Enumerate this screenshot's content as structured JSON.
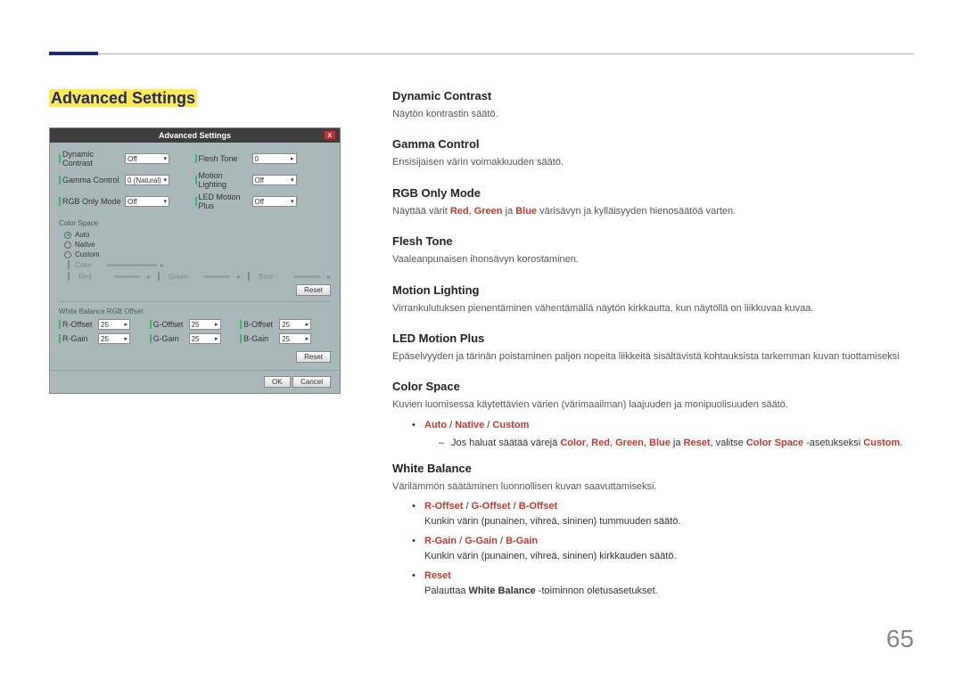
{
  "pageNumber": "65",
  "sectionTitle": "Advanced Settings",
  "dialog": {
    "title": "Advanced Settings",
    "close": "x",
    "topRows": [
      {
        "label": "Dynamic Contrast",
        "value": "Off",
        "label2": "Flesh Tone",
        "value2": "0"
      },
      {
        "label": "Gamma Control",
        "value": "0 (Natural)",
        "label2": "Motion Lighting",
        "value2": "Off"
      },
      {
        "label": "RGB Only Mode",
        "value": "Off",
        "label2": "LED Motion Plus",
        "value2": "Off"
      }
    ],
    "colorSpace": {
      "title": "Color Space",
      "options": [
        "Auto",
        "Native",
        "Custom"
      ],
      "sliders": [
        {
          "l": "Color",
          "v": ""
        }
      ],
      "rgbSliders": [
        {
          "l": "Red",
          "v": ""
        },
        {
          "l": "Green",
          "v": ""
        },
        {
          "l": "Blue",
          "v": ""
        }
      ],
      "reset": "Reset"
    },
    "whiteBalance": {
      "title": "White Balance RGB Offset",
      "rows": [
        [
          {
            "l": "R-Offset",
            "v": "25"
          },
          {
            "l": "G-Offset",
            "v": "25"
          },
          {
            "l": "B-Offset",
            "v": "25"
          }
        ],
        [
          {
            "l": "R-Gain",
            "v": "25"
          },
          {
            "l": "G-Gain",
            "v": "25"
          },
          {
            "l": "B-Gain",
            "v": "25"
          }
        ]
      ],
      "reset": "Reset"
    },
    "ok": "OK",
    "cancel": "Cancel"
  },
  "items": {
    "dynamicContrast": {
      "title": "Dynamic Contrast",
      "desc": "Näytön kontrastin säätö."
    },
    "gammaControl": {
      "title": "Gamma Control",
      "desc": "Ensisijaisen värin voimakkuuden säätö."
    },
    "rgbOnly": {
      "title": "RGB Only Mode",
      "descPre": "Näyttää värit ",
      "red": "Red",
      "sep1": ", ",
      "green": "Green",
      "sep2": " ja ",
      "blue": "Blue",
      "descPost": " värisävyn ja kylläisyyden hienosäätöä varten."
    },
    "fleshTone": {
      "title": "Flesh Tone",
      "desc": "Vaaleanpunaisen ihonsävyn korostaminen."
    },
    "motionLighting": {
      "title": "Motion Lighting",
      "desc": "Virrankulutuksen pienentäminen vähentämällä näytön kirkkautta, kun näytöllä on liikkuvaa kuvaa."
    },
    "ledMotionPlus": {
      "title": "LED Motion Plus",
      "desc": "Epäselvyyden ja tärinän poistaminen paljon nopeita liikkeitä sisältävistä kohtauksista tarkemman kuvan tuottamiseksi"
    },
    "colorSpace": {
      "title": "Color Space",
      "desc": "Kuvien luomisessa käytettävien värien (värimaailman) laajuuden ja monipuolisuuden säätö.",
      "opts": {
        "auto": "Auto",
        "native": "Native",
        "custom": "Custom",
        "sep": " / "
      },
      "subPre": "Jos haluat säätää värejä ",
      "color": "Color",
      "s1": ", ",
      "red": "Red",
      "s2": ", ",
      "green": "Green",
      "s3": ", ",
      "blue": "Blue",
      "s4": " ja ",
      "reset": "Reset",
      "s5": ", valitse ",
      "cs": "Color Space",
      "s6": " -asetukseksi ",
      "custom2": "Custom",
      "s7": "."
    },
    "whiteBalance": {
      "title": "White Balance",
      "desc": "Värilämmön säätäminen luonnollisen kuvan saavuttamiseksi.",
      "b1": {
        "r": "R-Offset",
        "sep": " / ",
        "g": "G-Offset",
        "b": "B-Offset",
        "txt": "Kunkin värin (punainen, vihreä, sininen) tummuuden säätö."
      },
      "b2": {
        "r": "R-Gain",
        "sep": " / ",
        "g": "G-Gain",
        "b": "B-Gain",
        "txt": "Kunkin värin (punainen, vihreä, sininen) kirkkauden säätö."
      },
      "b3": {
        "reset": "Reset",
        "pre": "Palauttaa ",
        "wb": "White Balance",
        "post": " -toiminnon oletusasetukset."
      }
    }
  }
}
